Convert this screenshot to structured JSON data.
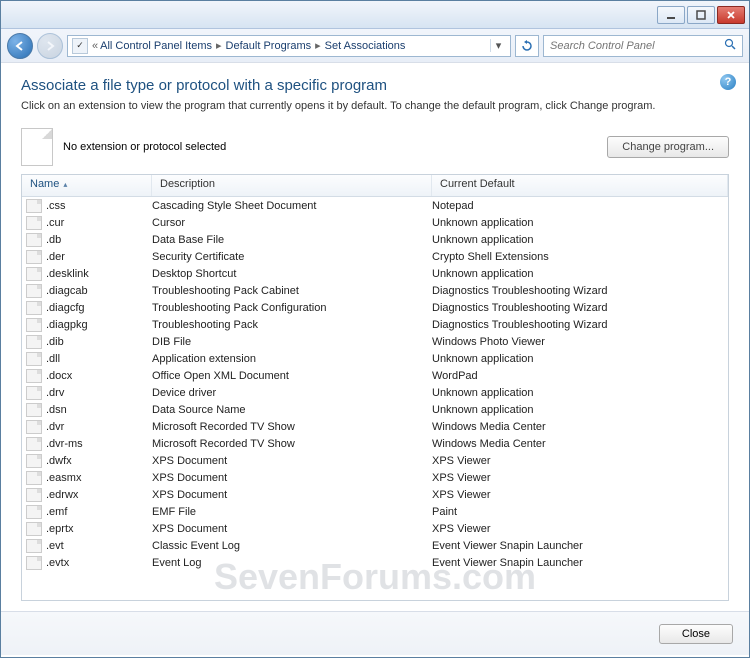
{
  "titlebar": {
    "min": "—",
    "max": "☐",
    "close": "✕"
  },
  "address": {
    "prefix": "«",
    "crumbs": [
      "All Control Panel Items",
      "Default Programs",
      "Set Associations"
    ]
  },
  "search": {
    "placeholder": "Search Control Panel"
  },
  "heading": "Associate a file type or protocol with a specific program",
  "subtitle": "Click on an extension to view the program that currently opens it by default. To change the default program, click Change program.",
  "selection": {
    "text": "No extension or protocol selected",
    "change_btn": "Change program..."
  },
  "columns": {
    "name": "Name",
    "desc": "Description",
    "def": "Current Default"
  },
  "rows": [
    {
      "ext": ".css",
      "desc": "Cascading Style Sheet Document",
      "def": "Notepad"
    },
    {
      "ext": ".cur",
      "desc": "Cursor",
      "def": "Unknown application"
    },
    {
      "ext": ".db",
      "desc": "Data Base File",
      "def": "Unknown application"
    },
    {
      "ext": ".der",
      "desc": "Security Certificate",
      "def": "Crypto Shell Extensions"
    },
    {
      "ext": ".desklink",
      "desc": "Desktop Shortcut",
      "def": "Unknown application"
    },
    {
      "ext": ".diagcab",
      "desc": "Troubleshooting Pack Cabinet",
      "def": "Diagnostics Troubleshooting Wizard"
    },
    {
      "ext": ".diagcfg",
      "desc": "Troubleshooting Pack Configuration",
      "def": "Diagnostics Troubleshooting Wizard"
    },
    {
      "ext": ".diagpkg",
      "desc": "Troubleshooting Pack",
      "def": "Diagnostics Troubleshooting Wizard"
    },
    {
      "ext": ".dib",
      "desc": "DIB File",
      "def": "Windows Photo Viewer"
    },
    {
      "ext": ".dll",
      "desc": "Application extension",
      "def": "Unknown application"
    },
    {
      "ext": ".docx",
      "desc": "Office Open XML Document",
      "def": "WordPad"
    },
    {
      "ext": ".drv",
      "desc": "Device driver",
      "def": "Unknown application"
    },
    {
      "ext": ".dsn",
      "desc": "Data Source Name",
      "def": "Unknown application"
    },
    {
      "ext": ".dvr",
      "desc": "Microsoft Recorded TV Show",
      "def": "Windows Media Center"
    },
    {
      "ext": ".dvr-ms",
      "desc": "Microsoft Recorded TV Show",
      "def": "Windows Media Center"
    },
    {
      "ext": ".dwfx",
      "desc": "XPS Document",
      "def": "XPS Viewer"
    },
    {
      "ext": ".easmx",
      "desc": "XPS Document",
      "def": "XPS Viewer"
    },
    {
      "ext": ".edrwx",
      "desc": "XPS Document",
      "def": "XPS Viewer"
    },
    {
      "ext": ".emf",
      "desc": "EMF File",
      "def": "Paint"
    },
    {
      "ext": ".eprtx",
      "desc": "XPS Document",
      "def": "XPS Viewer"
    },
    {
      "ext": ".evt",
      "desc": "Classic Event Log",
      "def": "Event Viewer Snapin Launcher"
    },
    {
      "ext": ".evtx",
      "desc": "Event Log",
      "def": "Event Viewer Snapin Launcher"
    }
  ],
  "footer": {
    "close": "Close"
  },
  "watermark": "SevenForums.com"
}
